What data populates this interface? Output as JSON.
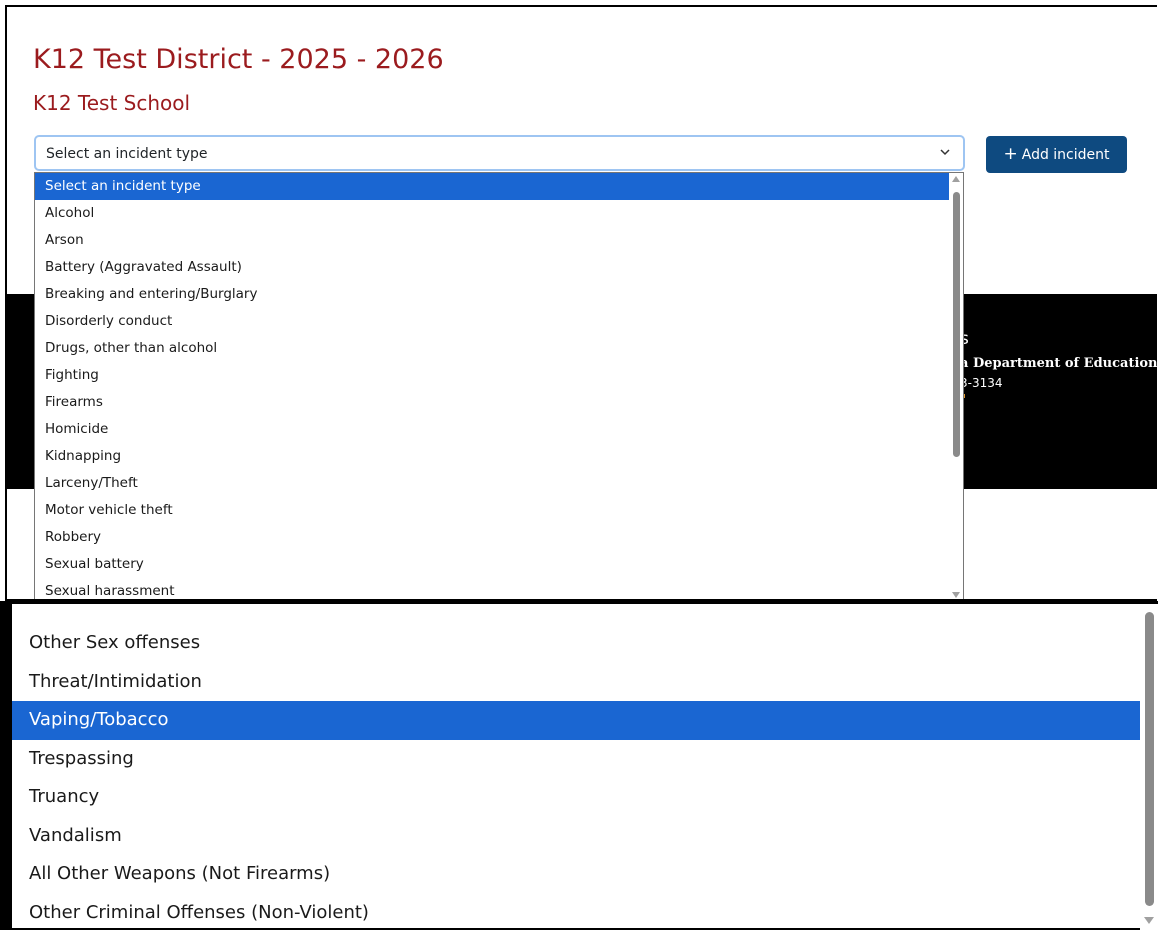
{
  "header": {
    "district_title": "K12 Test District - 2025 - 2026",
    "school_title": "K12 Test School"
  },
  "incident_select": {
    "current_value": "Select an incident type"
  },
  "add_button": {
    "icon": "plus-icon",
    "label": "Add incident"
  },
  "footer": {
    "heading_fragment": "s",
    "department_fragment": "a Department of Education",
    "phone_fragment": "3-3134"
  },
  "dropdown_top": {
    "selected_index": 0,
    "items": [
      "Select an incident type",
      "Alcohol",
      "Arson",
      "Battery (Aggravated Assault)",
      "Breaking and entering/Burglary",
      "Disorderly conduct",
      "Drugs, other than alcohol",
      "Fighting",
      "Firearms",
      "Homicide",
      "Kidnapping",
      "Larceny/Theft",
      "Motor vehicle theft",
      "Robbery",
      "Sexual battery",
      "Sexual harassment"
    ]
  },
  "dropdown_bottom": {
    "selected_index": 2,
    "items": [
      "Other Sex offenses",
      "Threat/Intimidation",
      "Vaping/Tobacco",
      "Trespassing",
      "Truancy",
      "Vandalism",
      "All Other Weapons (Not Firearms)",
      "Other Criminal Offenses (Non-Violent)"
    ]
  },
  "colors": {
    "title_red": "#9b1b1e",
    "button_blue": "#0e4a80",
    "selection_blue": "#1a66d2",
    "focus_border": "#9ec5f2"
  }
}
